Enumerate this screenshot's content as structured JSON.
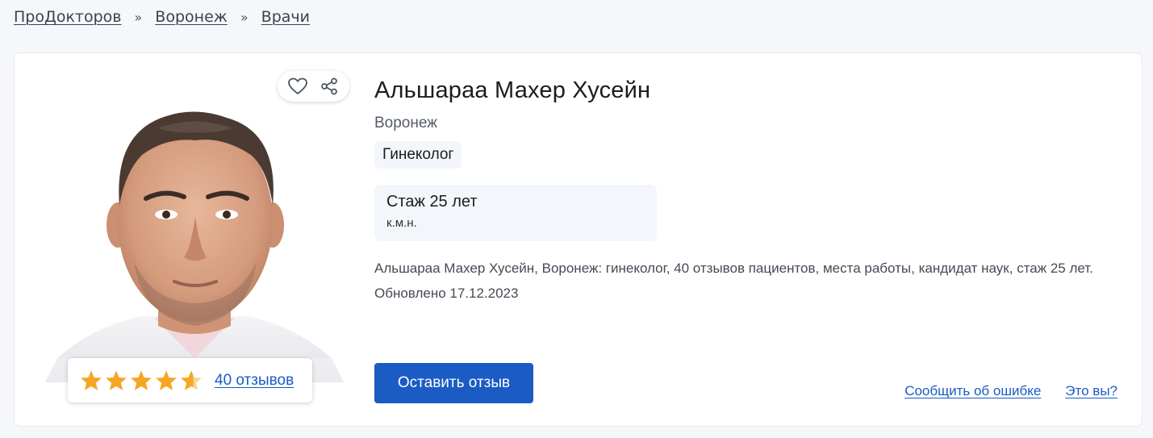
{
  "breadcrumb": {
    "items": [
      "ПроДокторов",
      "Воронеж",
      "Врачи"
    ],
    "separator": "»"
  },
  "doctor": {
    "name": "Альшараа Махер Хусейн",
    "city": "Воронеж",
    "specialty": "Гинеколог",
    "experience": "Стаж 25 лет",
    "degree": "к.м.н.",
    "description": "Альшараа Махер Хусейн, Воронеж: гинеколог, 40 отзывов пациентов, места работы, кандидат наук, стаж 25 лет.",
    "updated": "Обновлено 17.12.2023"
  },
  "rating": {
    "stars": 4.5,
    "reviews_link": "40 отзывов"
  },
  "actions": {
    "favorite_icon": "heart-icon",
    "share_icon": "share-icon",
    "leave_review": "Оставить отзыв",
    "report_error": "Сообщить об ошибке",
    "is_it_you": "Это вы?"
  },
  "colors": {
    "accent": "#1a5bc4",
    "star": "#f5a623"
  }
}
